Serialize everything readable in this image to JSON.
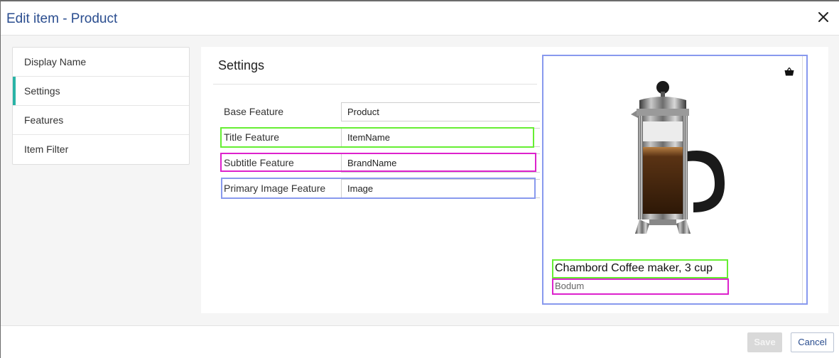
{
  "dialog": {
    "title": "Edit item - Product",
    "close_icon": "close-icon"
  },
  "sidebar": {
    "items": [
      {
        "label": "Display Name",
        "active": false
      },
      {
        "label": "Settings",
        "active": true
      },
      {
        "label": "Features",
        "active": false
      },
      {
        "label": "Item Filter",
        "active": false
      }
    ]
  },
  "settings": {
    "heading": "Settings",
    "rows": [
      {
        "label": "Base Feature",
        "value": "Product"
      },
      {
        "label": "Title Feature",
        "value": "ItemName"
      },
      {
        "label": "Subtitle Feature",
        "value": "BrandName"
      },
      {
        "label": "Primary Image Feature",
        "value": "Image"
      }
    ]
  },
  "preview": {
    "title": "Chambord Coffee maker, 3 cup",
    "subtitle": "Bodum",
    "basket_icon": "basket-icon",
    "image_icon": "french-press-image"
  },
  "highlight_colors": {
    "title": "#66ee33",
    "subtitle": "#dd22cc",
    "image": "#8899ee"
  },
  "footer": {
    "save_label": "Save",
    "cancel_label": "Cancel"
  }
}
